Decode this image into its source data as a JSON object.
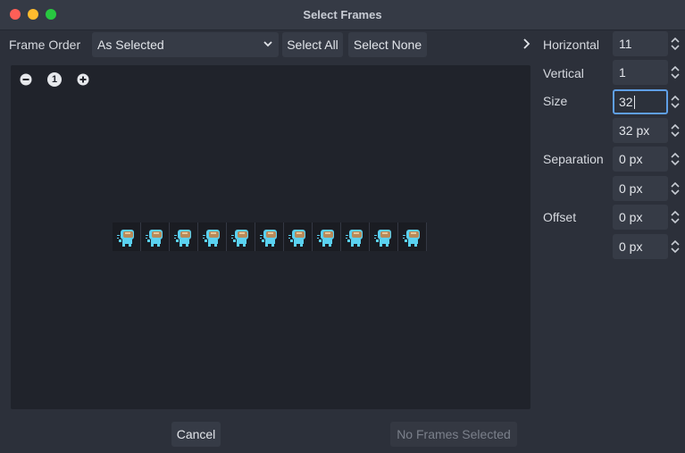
{
  "window": {
    "title": "Select Frames"
  },
  "toolbar": {
    "frame_order_label": "Frame Order",
    "frame_order_value": "As Selected",
    "select_all": "Select All",
    "select_none": "Select None"
  },
  "zoom": {
    "reset_label": "1"
  },
  "preview": {
    "frame_count": 11
  },
  "settings": {
    "horizontal_label": "Horizontal",
    "horizontal_value": "11",
    "vertical_label": "Vertical",
    "vertical_value": "1",
    "size_label": "Size",
    "size_x_value": "32",
    "size_y_value": "32 px",
    "separation_label": "Separation",
    "separation_x_value": "0 px",
    "separation_y_value": "0 px",
    "offset_label": "Offset",
    "offset_x_value": "0 px",
    "offset_y_value": "0 px"
  },
  "footer": {
    "cancel": "Cancel",
    "confirm": "No Frames Selected"
  },
  "colors": {
    "background": "#2c303a",
    "panel": "#20232b",
    "accent_focus": "#5f9fe6",
    "sprite_cyan": "#5ad1f0",
    "sprite_visor": "#b88a5a"
  }
}
